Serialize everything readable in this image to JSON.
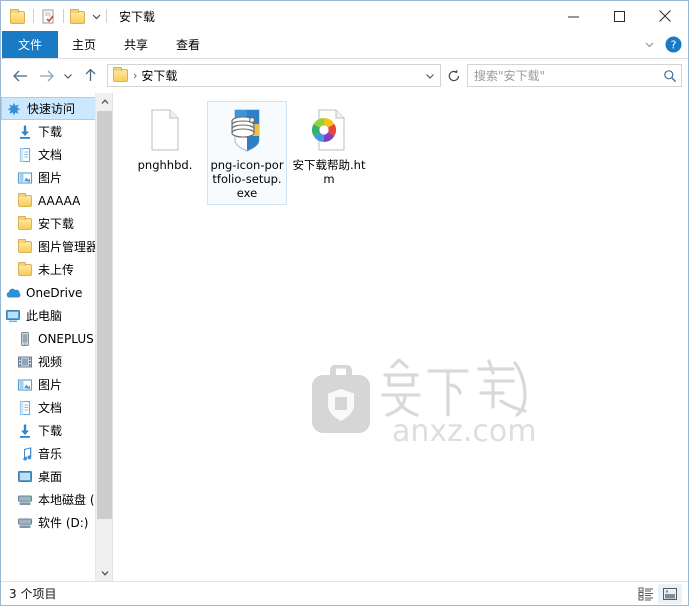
{
  "window": {
    "title": "安下载",
    "quick_access": [
      {
        "name": "folder-icon",
        "label": "文件夹"
      },
      {
        "name": "properties-icon",
        "label": "属性"
      },
      {
        "name": "new-folder-icon",
        "label": "新建文件夹"
      }
    ],
    "quick_access_dropdown": "自定义快速访问工具栏",
    "controls": {
      "minimize": "最小化",
      "maximize": "最大化",
      "close": "关闭"
    }
  },
  "ribbon": {
    "tabs": [
      {
        "label": "文件",
        "selected": true
      },
      {
        "label": "主页",
        "selected": false
      },
      {
        "label": "共享",
        "selected": false
      },
      {
        "label": "查看",
        "selected": false
      }
    ],
    "collapse_label": "展开功能区",
    "help_label": "帮助"
  },
  "address": {
    "back_label": "后退",
    "forward_label": "前进",
    "recent_label": "最近位置",
    "up_label": "上移一级",
    "breadcrumb": {
      "separator": "›",
      "path": [
        "安下载"
      ]
    },
    "dropdown_label": "前往",
    "refresh_label": "刷新",
    "search_placeholder": "搜索\"安下载\"",
    "search_value": ""
  },
  "sidebar": {
    "items": [
      {
        "label": "快速访问",
        "icon": "quick-access-star-icon",
        "selected": true,
        "indent": 0,
        "pinned": false
      },
      {
        "label": "下载",
        "icon": "downloads-icon",
        "selected": false,
        "indent": 1,
        "pinned": true
      },
      {
        "label": "文档",
        "icon": "documents-icon",
        "selected": false,
        "indent": 1,
        "pinned": true
      },
      {
        "label": "图片",
        "icon": "pictures-icon",
        "selected": false,
        "indent": 1,
        "pinned": true
      },
      {
        "label": "AAAAA",
        "icon": "folder-icon",
        "selected": false,
        "indent": 1,
        "pinned": false
      },
      {
        "label": "安下载",
        "icon": "folder-icon",
        "selected": false,
        "indent": 1,
        "pinned": false
      },
      {
        "label": "图片管理器",
        "icon": "folder-icon",
        "selected": false,
        "indent": 1,
        "pinned": false
      },
      {
        "label": "未上传",
        "icon": "folder-icon",
        "selected": false,
        "indent": 1,
        "pinned": false
      },
      {
        "label": "OneDrive",
        "icon": "onedrive-cloud-icon",
        "selected": false,
        "indent": 0,
        "pinned": false
      },
      {
        "label": "此电脑",
        "icon": "this-pc-icon",
        "selected": false,
        "indent": 0,
        "pinned": false
      },
      {
        "label": "ONEPLUS",
        "icon": "phone-icon",
        "selected": false,
        "indent": 1,
        "pinned": false
      },
      {
        "label": "视频",
        "icon": "videos-icon",
        "selected": false,
        "indent": 1,
        "pinned": false
      },
      {
        "label": "图片",
        "icon": "pictures-icon",
        "selected": false,
        "indent": 1,
        "pinned": false
      },
      {
        "label": "文档",
        "icon": "documents-icon",
        "selected": false,
        "indent": 1,
        "pinned": false
      },
      {
        "label": "下载",
        "icon": "downloads-icon",
        "selected": false,
        "indent": 1,
        "pinned": false
      },
      {
        "label": "音乐",
        "icon": "music-note-icon",
        "selected": false,
        "indent": 1,
        "pinned": false
      },
      {
        "label": "桌面",
        "icon": "desktop-icon",
        "selected": false,
        "indent": 1,
        "pinned": false
      },
      {
        "label": "本地磁盘 (",
        "icon": "hard-drive-icon",
        "selected": false,
        "indent": 1,
        "pinned": false
      },
      {
        "label": "软件 (D:)",
        "icon": "hard-drive-icon",
        "selected": false,
        "indent": 1,
        "pinned": false
      }
    ],
    "scroll_up_label": "向上滚动",
    "scroll_down_label": "向下滚动"
  },
  "files": [
    {
      "name": "pnghhbd.",
      "icon": "blank-document-icon",
      "selected": false
    },
    {
      "name": "png-icon-portfolio-setup.exe",
      "icon": "installer-exe-icon",
      "selected": true
    },
    {
      "name": "安下载帮助.htm",
      "icon": "html-document-icon",
      "selected": false
    }
  ],
  "watermark": {
    "text": "安下载",
    "domain": "anxz.com",
    "logo": "shopping-bag-shield-logo"
  },
  "statusbar": {
    "count_text": "3 个项目",
    "views": [
      {
        "name": "details-view-button",
        "label": "详细信息",
        "active": false
      },
      {
        "name": "large-icons-view-button",
        "label": "大图标",
        "active": true
      }
    ]
  },
  "colors": {
    "accent": "#1a7bc4",
    "selection": "#cce8ff",
    "selection_border": "#99d1ff",
    "folder_yellow": "#ffd977",
    "watermark_gray": "#d4d4d4"
  }
}
